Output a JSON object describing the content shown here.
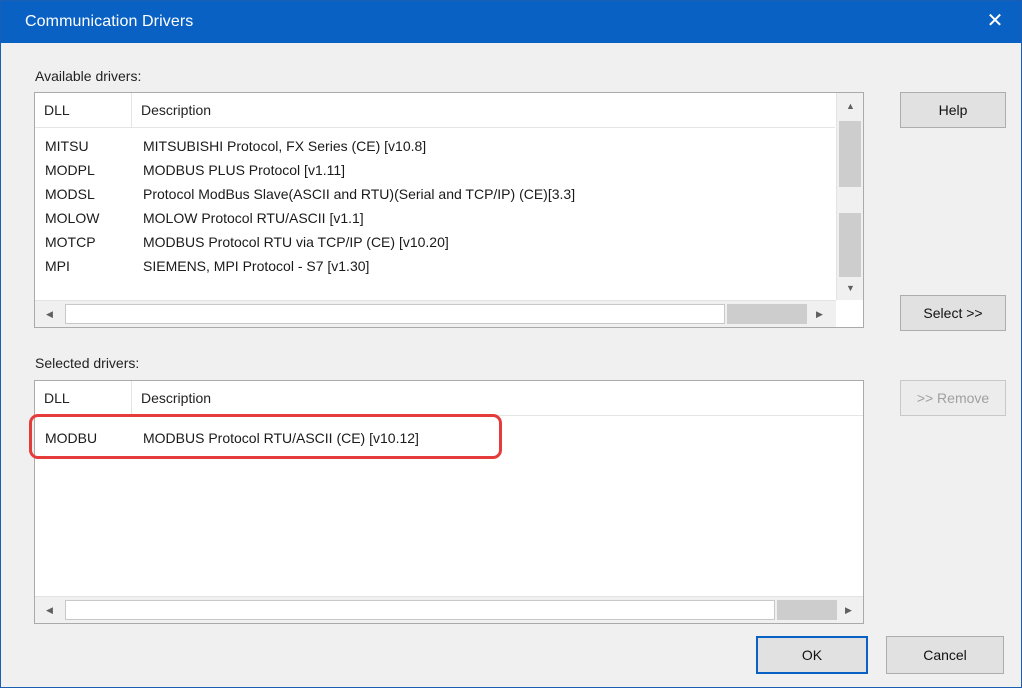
{
  "dialog": {
    "title": "Communication Drivers",
    "close_glyph": "✕"
  },
  "available": {
    "label": "Available drivers:",
    "headers": {
      "dll": "DLL",
      "description": "Description"
    },
    "rows": [
      {
        "dll": "MITSU",
        "description": "MITSUBISHI Protocol, FX Series (CE) [v10.8]"
      },
      {
        "dll": "MODPL",
        "description": "MODBUS PLUS Protocol  [v1.11]"
      },
      {
        "dll": "MODSL",
        "description": "Protocol ModBus Slave(ASCII and RTU)(Serial and TCP/IP) (CE)[3.3]"
      },
      {
        "dll": "MOLOW",
        "description": "MOLOW Protocol RTU/ASCII [v1.1]"
      },
      {
        "dll": "MOTCP",
        "description": "MODBUS Protocol RTU via TCP/IP (CE) [v10.20]"
      },
      {
        "dll": "MPI",
        "description": "SIEMENS, MPI Protocol - S7 [v1.30]"
      }
    ]
  },
  "selected": {
    "label": "Selected drivers:",
    "headers": {
      "dll": "DLL",
      "description": "Description"
    },
    "rows": [
      {
        "dll": "MODBU",
        "description": "MODBUS Protocol RTU/ASCII (CE) [v10.12]"
      }
    ]
  },
  "buttons": {
    "help": "Help",
    "select": "Select >>",
    "remove": ">> Remove",
    "ok": "OK",
    "cancel": "Cancel"
  },
  "icons": {
    "close": "close-icon",
    "scroll_up": "scroll-up-arrow-icon",
    "scroll_down": "scroll-down-arrow-icon",
    "scroll_left": "scroll-left-arrow-icon",
    "scroll_right": "scroll-right-arrow-icon"
  },
  "colors": {
    "titlebar": "#0a61c4",
    "highlight": "#e63b3b"
  }
}
